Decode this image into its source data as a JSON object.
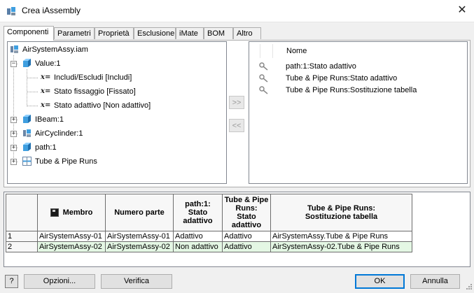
{
  "window": {
    "title": "Crea iAssembly",
    "icon": "assembly-icon",
    "close_glyph": "✕"
  },
  "tabs": [
    {
      "label": "Componenti",
      "active": true
    },
    {
      "label": "Parametri"
    },
    {
      "label": "Proprietà"
    },
    {
      "label": "Esclusione"
    },
    {
      "label": "iMate"
    },
    {
      "label": "BOM"
    },
    {
      "label": "Altro"
    }
  ],
  "tree": {
    "root": "AirSystemAssy.iam",
    "value1": "Value:1",
    "params": [
      "Includi/Escludi [Includi]",
      "Stato fissaggio [Fissato]",
      "Stato adattivo [Non adattivo]"
    ],
    "param_prefix": "x=",
    "ibeam": "IBeam:1",
    "aircyl": "AirCyclinder:1",
    "path": "path:1",
    "tube": "Tube & Pipe Runs",
    "expanded_glyph": "−",
    "collapsed_glyph": "+"
  },
  "move": {
    "add": ">>",
    "remove": "<<"
  },
  "selected_list": {
    "header": "Nome",
    "items": [
      "path:1:Stato adattivo",
      "Tube & Pipe Runs:Stato adattivo",
      "Tube & Pipe Runs:Sostituzione tabella"
    ]
  },
  "table": {
    "headers": {
      "membro": "Membro",
      "numero": "Numero parte",
      "col3_l1": "path:1:",
      "col3_l2": "Stato",
      "col3_l3": "adattivo",
      "col4_l1": "Tube & Pipe",
      "col4_l2": "Runs:",
      "col4_l3": "Stato",
      "col4_l4": "adattivo",
      "col5_l1": "Tube & Pipe Runs:",
      "col5_l2": "Sostituzione tabella"
    },
    "rows": [
      {
        "num": "1",
        "membro": "AirSystemAssy-01",
        "numero": "AirSystemAssy-01",
        "stato_path": "Adattivo",
        "stato_tube": "Adattivo",
        "sostituzione": "AirSystemAssy.Tube & Pipe Runs"
      },
      {
        "num": "2",
        "membro": "AirSystemAssy-02",
        "numero": "AirSystemAssy-02",
        "stato_path": "Non adattivo",
        "stato_tube": "Adattivo",
        "sostituzione": "AirSystemAssy-02.Tube & Pipe Runs"
      }
    ]
  },
  "buttons": {
    "help": "?",
    "opzioni": "Opzioni...",
    "verifica": "Verifica",
    "ok": "OK",
    "annulla": "Annulla"
  },
  "colors": {
    "accent": "#0078d7",
    "cube": "#3f9fe0",
    "row_green": "#e4f7e4"
  }
}
